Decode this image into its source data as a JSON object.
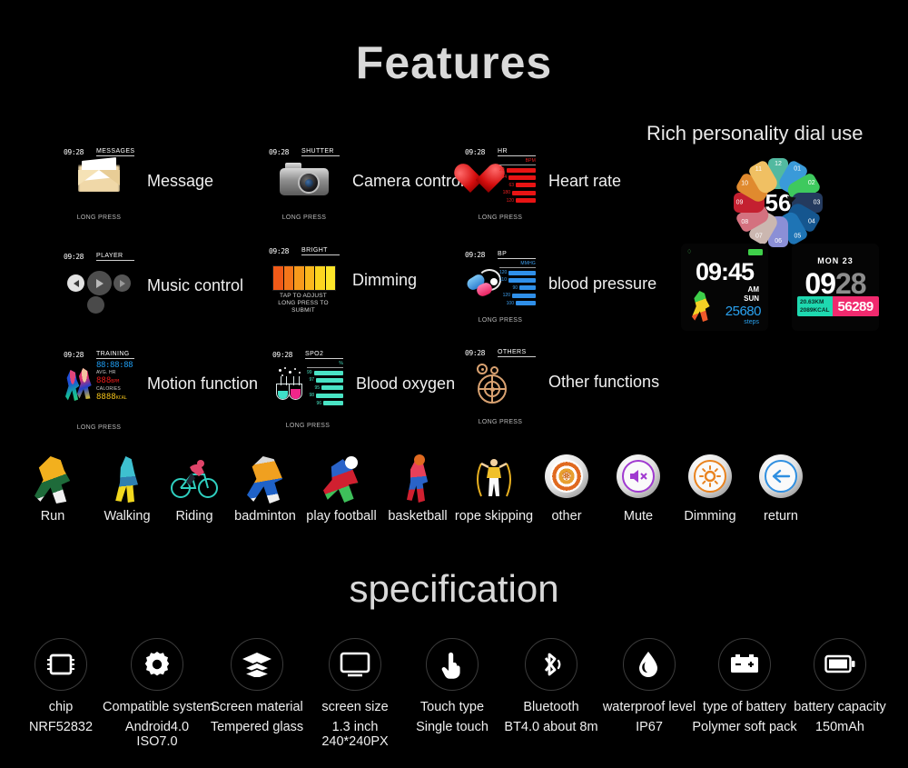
{
  "headings": {
    "features": "Features",
    "specification": "specification",
    "dial": "Rich personality dial use"
  },
  "features": [
    {
      "id": "message",
      "time": "09:28",
      "mode": "MESSAGES",
      "press": "LONG PRESS",
      "label": "Message",
      "icon": "envelope-icon"
    },
    {
      "id": "camera",
      "time": "09:28",
      "mode": "SHUTTER",
      "press": "LONG PRESS",
      "label": "Camera control",
      "icon": "camera-icon"
    },
    {
      "id": "heart",
      "time": "09:28",
      "mode": "HR",
      "press": "LONG PRESS",
      "label": "Heart rate",
      "icon": "heart-icon",
      "unit": "BPM",
      "values": [
        "20",
        "94",
        "63",
        "180",
        "120"
      ],
      "widths": [
        34,
        30,
        22,
        26,
        22
      ]
    },
    {
      "id": "music",
      "time": "09:28",
      "mode": "PLAYER",
      "press": "",
      "label": "Music control",
      "icon": "music-player-icon"
    },
    {
      "id": "dimming",
      "time": "09:28",
      "mode": "BRIGHT",
      "press": "",
      "label": "Dimming",
      "icon": "brightness-bar-icon",
      "hint1": "TAP TO ADJUST",
      "hint2": "LONG PRESS TO SUBMIT"
    },
    {
      "id": "bp",
      "time": "09:28",
      "mode": "BP",
      "press": "LONG PRESS",
      "label": "blood pressure",
      "icon": "blood-pressure-icon",
      "unit": "MMHG",
      "values": [
        "120",
        "110",
        "90",
        "120",
        "100"
      ],
      "widths": [
        34,
        30,
        18,
        26,
        22
      ]
    },
    {
      "id": "motion",
      "time": "09:28",
      "mode": "TRAINING",
      "press": "LONG PRESS",
      "label": "Motion function",
      "icon": "runners-icon",
      "timer": "88:88:88",
      "cap1": "AVG. HR",
      "hr": "888",
      "hr_unit": "BPM",
      "cap2": "CALORIES",
      "kcal": "8888",
      "kcal_unit": "KCAL"
    },
    {
      "id": "spo2",
      "time": "09:28",
      "mode": "SPO2",
      "press": "LONG PRESS",
      "label": "Blood oxygen",
      "icon": "flask-icon",
      "unit": "%",
      "values": [
        "99",
        "97",
        "95",
        "98",
        "96"
      ],
      "widths": [
        34,
        30,
        24,
        30,
        22
      ]
    },
    {
      "id": "others",
      "time": "09:28",
      "mode": "OTHERS",
      "press": "LONG PRESS",
      "label": "Other functions",
      "icon": "gears-icon"
    }
  ],
  "dial": {
    "center": "56",
    "segments": [
      {
        "num": "12",
        "color": "#52b9a0"
      },
      {
        "num": "01",
        "color": "#3a9ad9"
      },
      {
        "num": "02",
        "color": "#3ec95e"
      },
      {
        "num": "03",
        "color": "#243a5e"
      },
      {
        "num": "04",
        "color": "#15568f"
      },
      {
        "num": "05",
        "color": "#1e74b5"
      },
      {
        "num": "06",
        "color": "#8b8fd6"
      },
      {
        "num": "07",
        "color": "#cbb7b0"
      },
      {
        "num": "08",
        "color": "#d4717f"
      },
      {
        "num": "09",
        "color": "#c42030"
      },
      {
        "num": "10",
        "color": "#e08a2e"
      },
      {
        "num": "11",
        "color": "#f0c063"
      }
    ]
  },
  "watch_faces": [
    {
      "id": "face-steps",
      "time": "09:45",
      "meridiem": "AM",
      "weekday": "SUN",
      "steps": "25680",
      "steps_label": "steps"
    },
    {
      "id": "face-date",
      "date": "MON 23",
      "hours": "09",
      "minutes": "28",
      "distance": "20.63",
      "distance_unit": "KM",
      "calories": "2089",
      "calories_unit": "KCAL",
      "steps": "56289"
    }
  ],
  "sports": [
    {
      "id": "run",
      "label": "Run",
      "icon": "runner-icon",
      "type": "figure"
    },
    {
      "id": "walking",
      "label": "Walking",
      "icon": "walking-icon",
      "type": "figure"
    },
    {
      "id": "riding",
      "label": "Riding",
      "icon": "cyclist-icon",
      "type": "figure"
    },
    {
      "id": "badminton",
      "label": "badminton",
      "icon": "badminton-icon",
      "type": "figure"
    },
    {
      "id": "football",
      "label": "play football",
      "icon": "football-icon",
      "type": "figure"
    },
    {
      "id": "basketball",
      "label": "basketball",
      "icon": "basketball-icon",
      "type": "figure"
    },
    {
      "id": "rope",
      "label": "rope skipping",
      "icon": "rope-skipping-icon",
      "type": "figure"
    },
    {
      "id": "other",
      "label": "other",
      "icon": "other-target-icon",
      "type": "button",
      "color": "#e08a2e"
    },
    {
      "id": "mute",
      "label": "Mute",
      "icon": "mute-icon",
      "type": "button",
      "color": "#a03ad0"
    },
    {
      "id": "dimming",
      "label": "Dimming",
      "icon": "brightness-sun-icon",
      "type": "button",
      "color": "#e9831f"
    },
    {
      "id": "return",
      "label": "return",
      "icon": "back-arrow-icon",
      "type": "button",
      "color": "#2f8fe0"
    }
  ],
  "specs": [
    {
      "id": "chip",
      "icon": "chip-icon",
      "name": "chip",
      "value": "NRF52832",
      "value2": ""
    },
    {
      "id": "system",
      "icon": "gear-icon",
      "name": "Compatible system",
      "value": "Android4.0",
      "value2": "ISO7.0"
    },
    {
      "id": "screen-material",
      "icon": "layers-icon",
      "name": "Screen material",
      "value": "Tempered glass",
      "value2": ""
    },
    {
      "id": "screen-size",
      "icon": "monitor-icon",
      "name": "screen size",
      "value": "1.3 inch",
      "value2": "240*240PX"
    },
    {
      "id": "touch-type",
      "icon": "hand-touch-icon",
      "name": "Touch type",
      "value": "Single touch",
      "value2": ""
    },
    {
      "id": "bluetooth",
      "icon": "bluetooth-icon",
      "name": "Bluetooth",
      "value": "BT4.0  about 8m",
      "value2": ""
    },
    {
      "id": "waterproof",
      "icon": "water-drop-icon",
      "name": "waterproof level",
      "value": "IP67",
      "value2": ""
    },
    {
      "id": "battery-type",
      "icon": "battery-type-icon",
      "name": "type of battery",
      "value": "Polymer soft pack",
      "value2": ""
    },
    {
      "id": "battery-capacity",
      "icon": "battery-icon",
      "name": "battery capacity",
      "value": "150mAh",
      "value2": ""
    }
  ],
  "colors": {
    "background": "#000000",
    "text": "#efefef",
    "heart": "#e81414",
    "bp": "#2f8fe8",
    "spo2": "#49e3c4",
    "steps": "#2aa2f0",
    "calories": "#f2c21a"
  }
}
